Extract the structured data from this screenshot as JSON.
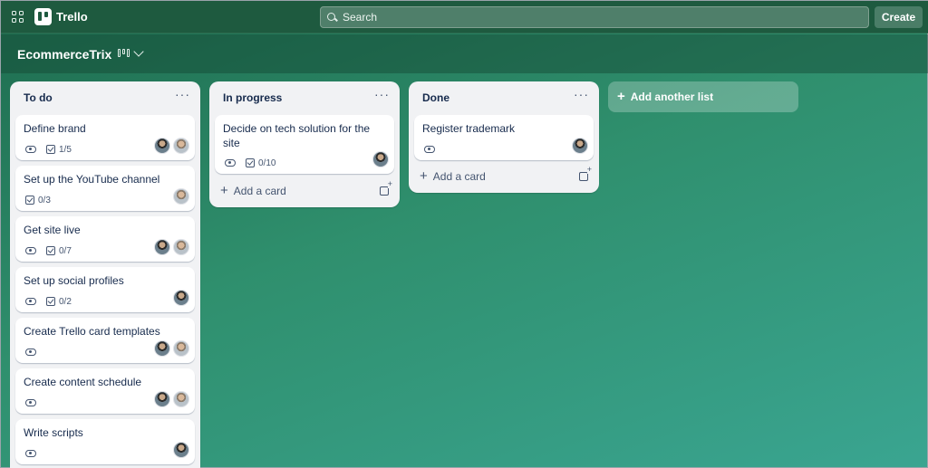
{
  "topbar": {
    "app_name": "Trello",
    "search_placeholder": "Search",
    "create_label": "Create"
  },
  "board": {
    "title": "EcommerceTrix"
  },
  "lists": [
    {
      "title": "To do",
      "menu": "···",
      "cards": [
        {
          "title": "Define brand",
          "checklist": "1/5",
          "watch": true,
          "members": 2
        },
        {
          "title": "Set up the YouTube channel",
          "checklist": "0/3",
          "watch": false,
          "members": 1
        },
        {
          "title": "Get site live",
          "checklist": "0/7",
          "watch": true,
          "members": 2
        },
        {
          "title": "Set up social profiles",
          "checklist": "0/2",
          "watch": true,
          "members": 1
        },
        {
          "title": "Create Trello card templates",
          "checklist": "",
          "watch": true,
          "members": 2
        },
        {
          "title": "Create content schedule",
          "checklist": "",
          "watch": true,
          "members": 2
        },
        {
          "title": "Write scripts",
          "checklist": "",
          "watch": true,
          "members": 1
        }
      ]
    },
    {
      "title": "In progress",
      "menu": "···",
      "add_card": "Add a card",
      "cards": [
        {
          "title": "Decide on tech solution for the site",
          "checklist": "0/10",
          "watch": true,
          "members": 1
        }
      ]
    },
    {
      "title": "Done",
      "menu": "···",
      "add_card": "Add a card",
      "cards": [
        {
          "title": "Register trademark",
          "checklist": "",
          "watch": true,
          "members": 1
        }
      ]
    }
  ],
  "add_list_label": "Add another list",
  "plus_glyph": "+"
}
